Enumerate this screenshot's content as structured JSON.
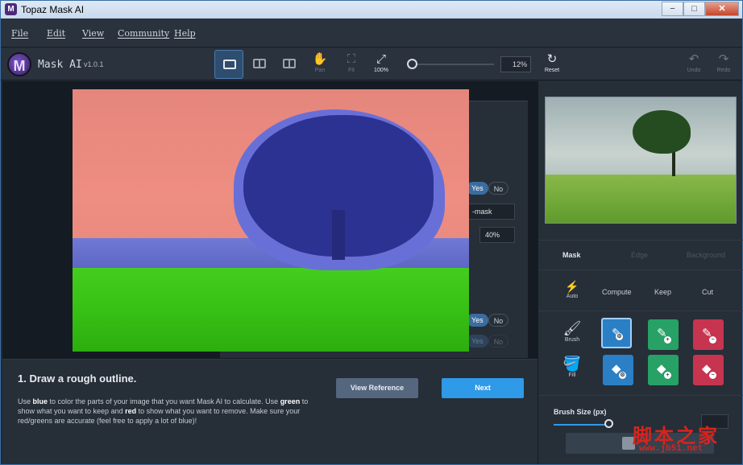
{
  "window": {
    "title": "Topaz Mask AI",
    "app_icon": "M",
    "min": "−",
    "max": "□",
    "close": "✕"
  },
  "menu": [
    "File",
    "Edit",
    "View",
    "Community",
    "Help"
  ],
  "toolbar": {
    "logo_letter": "M",
    "app_name": "Mask AI",
    "version": "v1.0.1",
    "pan": "Pan",
    "fit": "Fit",
    "zoom100": "100%",
    "zoom_value": "12%",
    "reset": "Reset",
    "undo": "Undo",
    "redo": "Redo"
  },
  "ghost_panel": {
    "yes": "Yes",
    "no": "No",
    "field1": "-mask",
    "percent": "40%",
    "yes2": "Yes",
    "no2": "No",
    "yes3": "Yes",
    "no3": "No"
  },
  "instructions": {
    "title": "1. Draw a rough outline.",
    "t1": "Use ",
    "blue": "blue",
    "t2": " to color the parts of your image that you want Mask AI to calculate. Use ",
    "green": "green",
    "t3": " to show what you want to keep and ",
    "red": "red",
    "t4": " to show what you want to remove. Make sure your red/greens are accurate (feel free to apply a lot of blue)!",
    "view_reference": "View Reference",
    "next": "Next"
  },
  "right_panel": {
    "tabs": [
      "Mask",
      "Edge",
      "Background"
    ],
    "auto": "Auto",
    "compute": "Compute",
    "keep": "Keep",
    "cut": "Cut",
    "brush": "Brush",
    "fill": "Fill",
    "brush_size": "Brush Size (px)"
  },
  "watermark": {
    "text": "脚本之家",
    "url": "www.jb51.net"
  },
  "colors": {
    "accent": "#2e9ae8",
    "compute": "#2b7fc4",
    "keep": "#27a165",
    "cut": "#c63450"
  }
}
